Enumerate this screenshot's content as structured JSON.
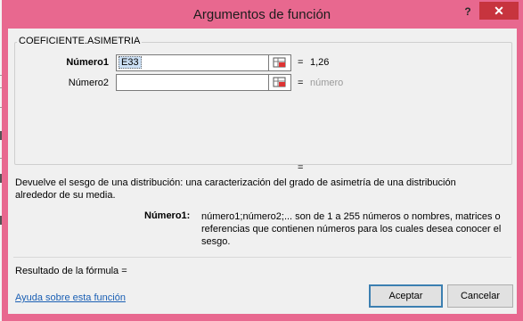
{
  "dialog": {
    "title": "Argumentos de función",
    "help_label": "?",
    "close_label": "✕"
  },
  "function": {
    "name": "COEFICIENTE.ASIMETRIA",
    "args": [
      {
        "label": "Número1",
        "input_value": "E33",
        "equals": "=",
        "result": "1,26"
      },
      {
        "label": "Número2",
        "input_value": "",
        "equals": "=",
        "result": "número"
      }
    ],
    "total_equals": "="
  },
  "description": "Devuelve el sesgo de una distribución: una caracterización del grado de asimetría de una distribución alrededor de su media.",
  "arg_description": {
    "label": "Número1:",
    "text": "número1;número2;... son de 1 a 255 números o nombres, matrices o referencias que contienen números para los cuales desea conocer el sesgo."
  },
  "formula_result": "Resultado de la fórmula =",
  "help_link": "Ayuda sobre esta función",
  "buttons": {
    "ok": "Aceptar",
    "cancel": "Cancelar"
  },
  "colors": {
    "title_bar": "#e8688f",
    "close": "#c7343e",
    "client": "#f0f0f0",
    "link": "#1a5fb4"
  },
  "icons": {
    "ref": "range-selector-icon"
  }
}
